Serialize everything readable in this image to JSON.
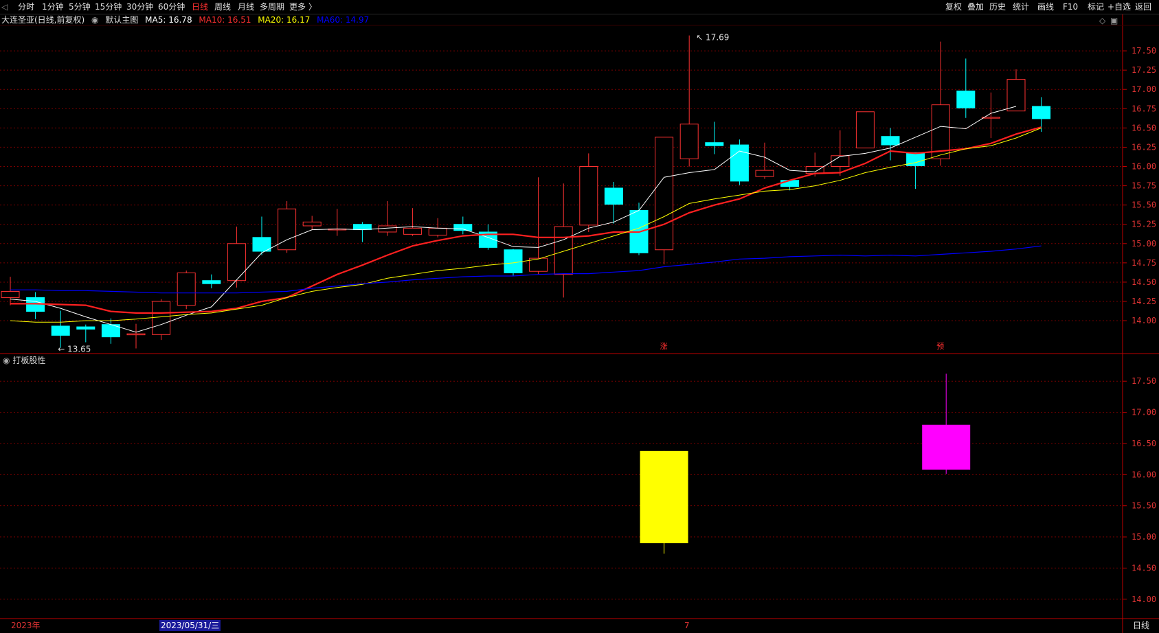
{
  "toolbar": {
    "periods": [
      "分时",
      "1分钟",
      "5分钟",
      "15分钟",
      "30分钟",
      "60分钟",
      "日线",
      "周线",
      "月线",
      "多周期",
      "更多 〉"
    ],
    "active_period": "日线",
    "right_buttons": [
      "复权",
      "叠加",
      "历史",
      "统计",
      "画线",
      "F10",
      "标记",
      "+自选",
      "返回"
    ]
  },
  "info": {
    "stock_name": "大连圣亚(日线,前复权)",
    "main_chart": "默认主图",
    "ma5": "MA5: 16.78",
    "ma10": "MA10: 16.51",
    "ma20": "MA20: 16.17",
    "ma60": "MA60: 14.97"
  },
  "colors": {
    "up": "#ff3232",
    "down": "#00ffff",
    "ma5": "#ffffff",
    "ma10": "#ff2020",
    "ma20": "#ffff00",
    "ma60": "#0000ff",
    "grid": "#7a0000",
    "indicator_1": "#ffff00",
    "indicator_2": "#ff00ff"
  },
  "main_chart": {
    "high_label": "17.69",
    "low_label": "13.65",
    "marker_1": "涨",
    "marker_2": "预",
    "y_ticks": [
      "17.50",
      "17.25",
      "17.00",
      "16.75",
      "16.50",
      "16.25",
      "16.00",
      "15.75",
      "15.50",
      "15.25",
      "15.00",
      "14.75",
      "14.50",
      "14.25",
      "14.00"
    ]
  },
  "indicator": {
    "label": "打板股性",
    "y_ticks": [
      "17.50",
      "17.00",
      "16.50",
      "16.00",
      "15.50",
      "15.00",
      "14.50",
      "14.00"
    ]
  },
  "bottom": {
    "year_label": "2023年",
    "date_label": "2023/05/31/三",
    "mid_label": "7",
    "period_label": "日线"
  },
  "chart_data": {
    "type": "candlestick",
    "series": [
      {
        "name": "K线",
        "ohlc": [
          [
            14.3,
            14.38,
            14.57,
            14.2
          ],
          [
            14.3,
            14.12,
            14.37,
            14.02
          ],
          [
            13.93,
            13.81,
            14.13,
            13.65
          ],
          [
            13.92,
            13.89,
            13.95,
            13.72
          ],
          [
            13.95,
            13.79,
            14.03,
            13.7
          ],
          [
            13.82,
            13.83,
            13.96,
            13.64
          ],
          [
            13.82,
            14.25,
            14.28,
            13.75
          ],
          [
            14.2,
            14.62,
            14.65,
            14.15
          ],
          [
            14.52,
            14.48,
            14.6,
            14.42
          ],
          [
            14.52,
            15.0,
            15.22,
            14.43
          ],
          [
            15.08,
            14.9,
            15.35,
            14.85
          ],
          [
            14.92,
            15.45,
            15.55,
            14.88
          ],
          [
            15.23,
            15.28,
            15.36,
            15.18
          ],
          [
            15.18,
            15.19,
            15.45,
            15.1
          ],
          [
            15.25,
            15.18,
            15.28,
            15.02
          ],
          [
            15.15,
            15.23,
            15.55,
            15.1
          ],
          [
            15.12,
            15.2,
            15.46,
            15.1
          ],
          [
            15.11,
            15.2,
            15.33,
            15.08
          ],
          [
            15.25,
            15.17,
            15.35,
            15.12
          ],
          [
            15.15,
            14.95,
            15.25,
            14.92
          ],
          [
            14.92,
            14.62,
            14.93,
            14.58
          ],
          [
            14.64,
            14.81,
            15.86,
            14.6
          ],
          [
            14.6,
            15.22,
            15.78,
            14.3
          ],
          [
            15.24,
            16.0,
            16.17,
            15.15
          ],
          [
            15.72,
            15.51,
            15.8,
            15.26
          ],
          [
            15.43,
            14.88,
            15.53,
            14.85
          ],
          [
            14.92,
            16.38,
            16.38,
            14.73
          ],
          [
            16.1,
            16.55,
            17.7,
            16.0
          ],
          [
            16.31,
            16.27,
            16.58,
            16.16
          ],
          [
            16.28,
            15.81,
            16.35,
            15.76
          ],
          [
            15.87,
            15.95,
            16.31,
            15.84
          ],
          [
            15.82,
            15.74,
            15.82,
            15.69
          ],
          [
            15.91,
            16.0,
            16.18,
            15.87
          ],
          [
            16.0,
            16.14,
            16.47,
            15.88
          ],
          [
            16.24,
            16.71,
            16.71,
            16.24
          ],
          [
            16.39,
            16.28,
            16.5,
            16.08
          ],
          [
            16.18,
            16.01,
            16.17,
            15.71
          ],
          [
            16.1,
            16.8,
            17.62,
            16.01
          ],
          [
            16.98,
            16.76,
            17.4,
            16.63
          ],
          [
            16.63,
            16.64,
            16.96,
            16.37
          ],
          [
            16.72,
            17.13,
            17.26,
            16.72
          ],
          [
            16.78,
            16.62,
            16.9,
            16.45
          ]
        ]
      },
      {
        "name": "MA5",
        "values": [
          14.28,
          14.25,
          14.16,
          14.05,
          13.95,
          13.85,
          13.95,
          14.07,
          14.18,
          14.53,
          14.88,
          15.05,
          15.18,
          15.19,
          15.18,
          15.2,
          15.22,
          15.2,
          15.19,
          15.08,
          14.96,
          14.95,
          15.05,
          15.2,
          15.28,
          15.43,
          15.86,
          15.92,
          15.96,
          16.2,
          16.12,
          15.95,
          15.93,
          16.13,
          16.17,
          16.24,
          16.38,
          16.52,
          16.49,
          16.69,
          16.78
        ]
      },
      {
        "name": "MA10",
        "values": [
          14.22,
          14.22,
          14.21,
          14.2,
          14.12,
          14.1,
          14.1,
          14.11,
          14.12,
          14.16,
          14.25,
          14.3,
          14.45,
          14.6,
          14.72,
          14.85,
          14.97,
          15.04,
          15.1,
          15.12,
          15.12,
          15.08,
          15.08,
          15.1,
          15.15,
          15.15,
          15.25,
          15.4,
          15.5,
          15.58,
          15.72,
          15.82,
          15.91,
          15.92,
          16.04,
          16.2,
          16.17,
          16.2,
          16.23,
          16.3,
          16.42,
          16.51
        ]
      },
      {
        "name": "MA20",
        "values": [
          14.0,
          13.98,
          13.98,
          14.0,
          14.0,
          14.02,
          14.05,
          14.08,
          14.1,
          14.15,
          14.2,
          14.3,
          14.38,
          14.43,
          14.47,
          14.55,
          14.6,
          14.65,
          14.68,
          14.72,
          14.75,
          14.8,
          14.9,
          15.0,
          15.1,
          15.2,
          15.35,
          15.52,
          15.58,
          15.63,
          15.68,
          15.7,
          15.75,
          15.82,
          15.92,
          15.99,
          16.05,
          16.15,
          16.23,
          16.27,
          16.37,
          16.5
        ]
      },
      {
        "name": "MA60",
        "values": [
          14.4,
          14.4,
          14.39,
          14.39,
          14.38,
          14.37,
          14.36,
          14.36,
          14.36,
          14.36,
          14.37,
          14.38,
          14.42,
          14.45,
          14.48,
          14.5,
          14.53,
          14.55,
          14.57,
          14.58,
          14.58,
          14.6,
          14.61,
          14.61,
          14.63,
          14.65,
          14.7,
          14.73,
          14.76,
          14.8,
          14.81,
          14.83,
          14.84,
          14.85,
          14.84,
          14.85,
          14.84,
          14.86,
          14.88,
          14.9,
          14.93,
          14.97
        ]
      }
    ],
    "indicator_bars": [
      {
        "index": 26,
        "open": 14.9,
        "close": 16.38,
        "high": 16.38,
        "low": 14.73
      },
      {
        "index": 37,
        "open": 16.08,
        "close": 16.8,
        "high": 17.62,
        "low": 16.01
      }
    ],
    "ylim_main": [
      13.6,
      17.75
    ],
    "ylim_indicator": [
      13.7,
      17.8
    ]
  }
}
